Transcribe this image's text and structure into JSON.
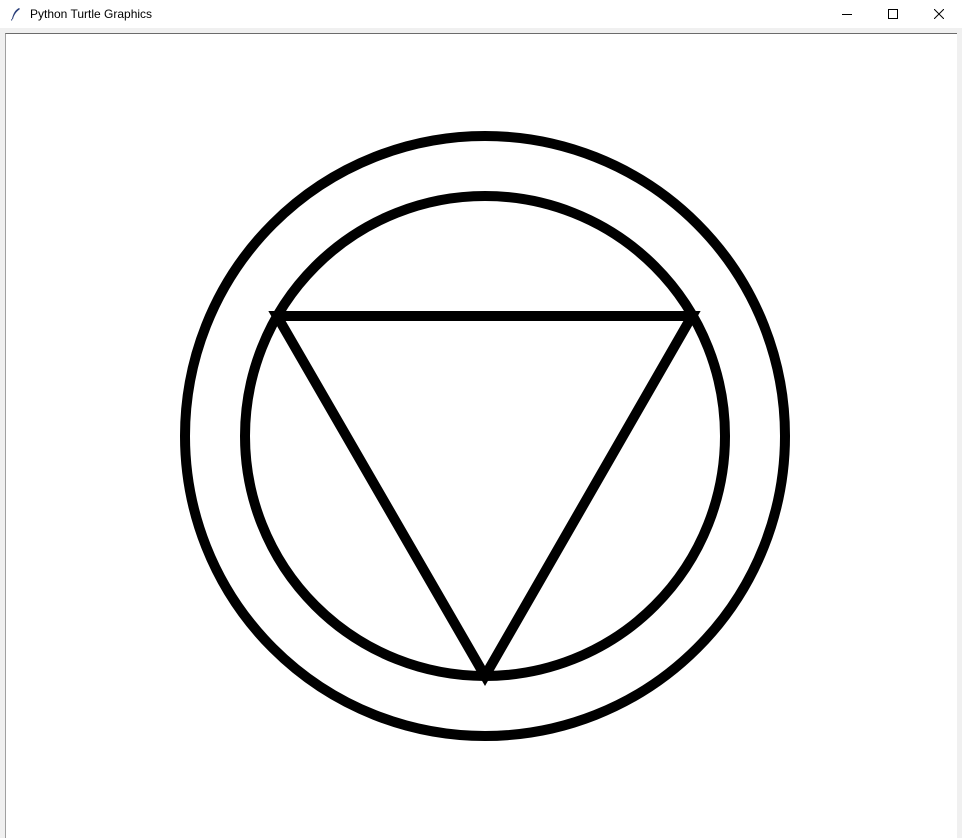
{
  "window": {
    "title": "Python Turtle Graphics",
    "app_icon": "feather-icon",
    "controls": {
      "minimize": "minimize-icon",
      "maximize": "maximize-icon",
      "close": "close-icon"
    }
  },
  "canvas": {
    "background": "#ffffff",
    "stroke_color": "#000000",
    "shapes": [
      {
        "type": "circle",
        "name": "outer-circle"
      },
      {
        "type": "circle",
        "name": "inner-circle"
      },
      {
        "type": "triangle",
        "name": "inscribed-triangle"
      },
      {
        "type": "turtle",
        "name": "turtle-cursor",
        "shape": "classic"
      }
    ]
  }
}
